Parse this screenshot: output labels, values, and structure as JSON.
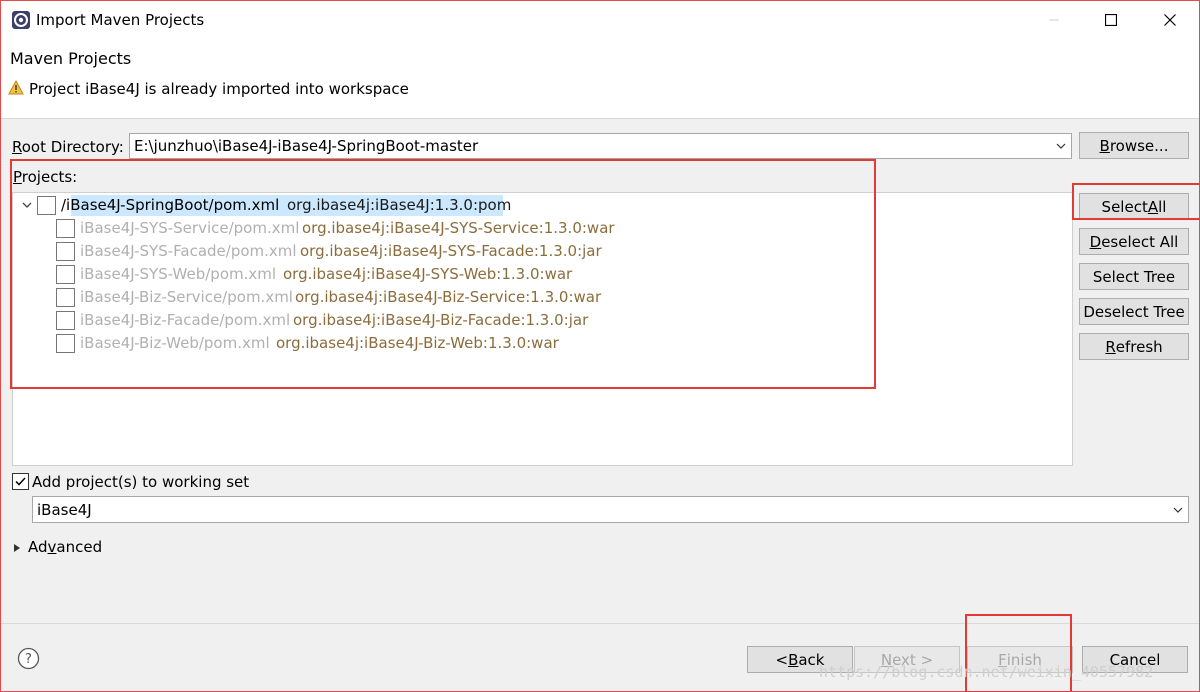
{
  "window": {
    "title": "Import Maven Projects"
  },
  "header": {
    "title": "Maven Projects",
    "message": "Project iBase4J is already imported into workspace"
  },
  "root": {
    "label": "Root Directory:",
    "value": "E:\\junzhuo\\iBase4J-iBase4J-SpringBoot-master",
    "browse_label": "Browse..."
  },
  "projects": {
    "label": "Projects:",
    "items": [
      {
        "name": "/iBase4J-SpringBoot/pom.xml",
        "coord": "org.ibase4j:iBase4J:1.3.0:pom",
        "checked": false,
        "enabled": true
      },
      {
        "name": "iBase4J-SYS-Service/pom.xml",
        "coord": "org.ibase4j:iBase4J-SYS-Service:1.3.0:war",
        "checked": false,
        "enabled": false
      },
      {
        "name": "iBase4J-SYS-Facade/pom.xml",
        "coord": "org.ibase4j:iBase4J-SYS-Facade:1.3.0:jar",
        "checked": false,
        "enabled": false
      },
      {
        "name": "iBase4J-SYS-Web/pom.xml",
        "coord": "org.ibase4j:iBase4J-SYS-Web:1.3.0:war",
        "checked": false,
        "enabled": false
      },
      {
        "name": "iBase4J-Biz-Service/pom.xml",
        "coord": "org.ibase4j:iBase4J-Biz-Service:1.3.0:war",
        "checked": false,
        "enabled": false
      },
      {
        "name": "iBase4J-Biz-Facade/pom.xml",
        "coord": "org.ibase4j:iBase4J-Biz-Facade:1.3.0:jar",
        "checked": false,
        "enabled": false
      },
      {
        "name": "iBase4J-Biz-Web/pom.xml",
        "coord": "org.ibase4j:iBase4J-Biz-Web:1.3.0:war",
        "checked": false,
        "enabled": false
      }
    ]
  },
  "side_buttons": {
    "select_all": "Select All",
    "deselect_all": "Deselect All",
    "select_tree": "Select Tree",
    "deselect_tree": "Deselect Tree",
    "refresh": "Refresh"
  },
  "working_set": {
    "label": "Add project(s) to working set",
    "checked": true,
    "value": "iBase4J"
  },
  "advanced": {
    "label": "Advanced"
  },
  "footer": {
    "back": "< Back",
    "next": "Next >",
    "finish": "Finish",
    "cancel": "Cancel"
  },
  "watermark": "https://blog.csdn.net/weixin_40557982",
  "colors": {
    "accent_red": "#e53935",
    "selection": "#cce8ff",
    "maven_coord": "#8b6d3c",
    "disabled_text": "#b0b0b0"
  }
}
